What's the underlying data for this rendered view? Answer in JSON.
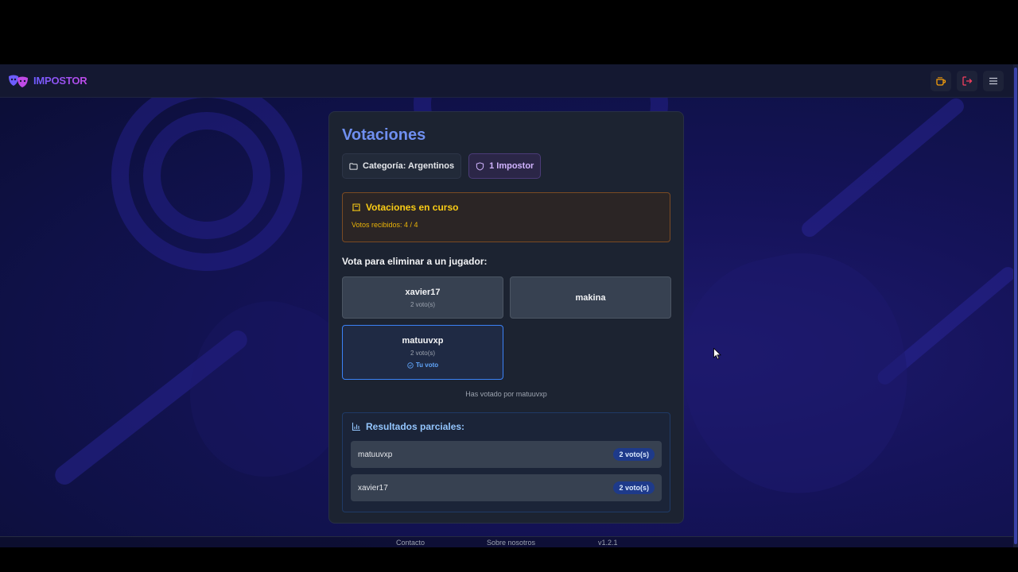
{
  "brand": {
    "name": "IMPOSTOR",
    "logo_icon": "theater-masks-icon"
  },
  "navbar": {
    "actions": [
      "coffee-icon",
      "logout-icon",
      "menu-icon"
    ]
  },
  "card": {
    "title": "Votaciones",
    "category_chip": "Categoría: Argentinos",
    "impostor_chip": "1 Impostor"
  },
  "status": {
    "title": "Votaciones en curso",
    "votes_received": "Votos recibidos: 4 / 4"
  },
  "voting": {
    "prompt": "Vota para eliminar a un jugador:",
    "players": [
      {
        "name": "xavier17",
        "votes": "2 voto(s)"
      },
      {
        "name": "makina",
        "votes": ""
      },
      {
        "name": "matuuvxp",
        "votes": "2 voto(s)",
        "your_vote": "Tu voto"
      }
    ],
    "voted_note": "Has votado por matuuvxp"
  },
  "results": {
    "title": "Resultados parciales:",
    "rows": [
      {
        "name": "matuuvxp",
        "votes": "2 voto(s)"
      },
      {
        "name": "xavier17",
        "votes": "2 voto(s)"
      }
    ]
  },
  "footer": {
    "contact": "Contacto",
    "about": "Sobre nosotros",
    "version": "v1.2.1"
  },
  "colors": {
    "accent": "#6f8ff0",
    "warning": "#facc15",
    "selected": "#3b82f6",
    "badge": "#1e3a8a"
  }
}
